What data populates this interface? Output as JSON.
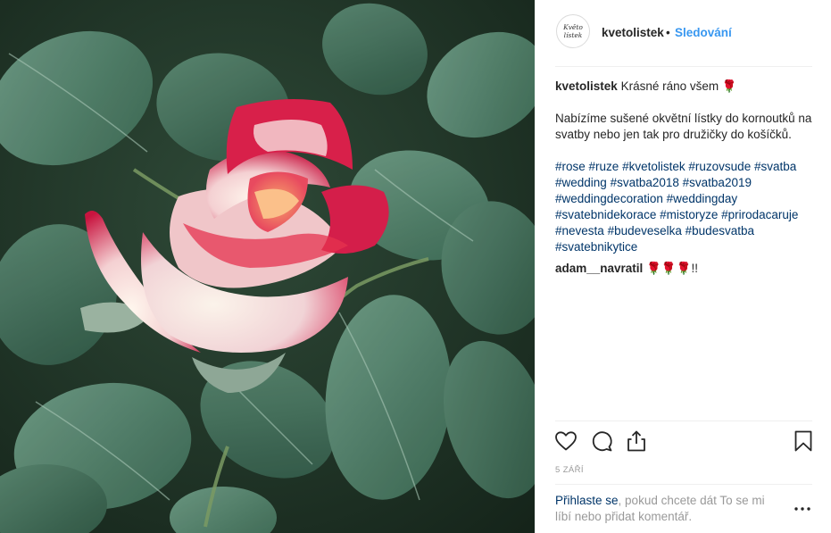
{
  "post": {
    "image_alt": "rose",
    "header": {
      "avatar_line1": "Květo",
      "avatar_line2": "lístek",
      "username": "kvetolistek",
      "separator": "•",
      "follow_label": "Sledování"
    },
    "caption": {
      "username": "kvetolistek",
      "text": "Krásné ráno všem 🌹",
      "body": "Nabízíme sušené okvětní lístky do kornoutků na svatby nebo jen tak pro družičky do košíčků.",
      "hashtags": [
        "#rose",
        "#ruze",
        "#kvetolistek",
        "#ruzovsude",
        "#svatba",
        "#wedding",
        "#svatba2018",
        "#svatba2019",
        "#weddingdecoration",
        "#weddingday",
        "#svatebnidekorace",
        "#mistoryze",
        "#prirodacaruje",
        "#nevesta",
        "#budeveselka",
        "#budesvatba",
        "#svatebnikytice"
      ]
    },
    "comment": {
      "username": "adam__navratil",
      "text": "🌹🌹🌹!!"
    },
    "actions": {
      "like_icon": "heart-icon",
      "comment_icon": "speech-bubble-icon",
      "share_icon": "share-icon",
      "save_icon": "bookmark-icon"
    },
    "date": "5 ZÁŘÍ",
    "login_prompt": {
      "link": "Přihlaste se",
      "text": ", pokud chcete dát To se mi líbí nebo přidat komentář."
    },
    "colors": {
      "link_blue": "#3897f0",
      "hashtag_blue": "#003569",
      "muted_gray": "#999999",
      "rose_pink": "#d8204a"
    }
  }
}
